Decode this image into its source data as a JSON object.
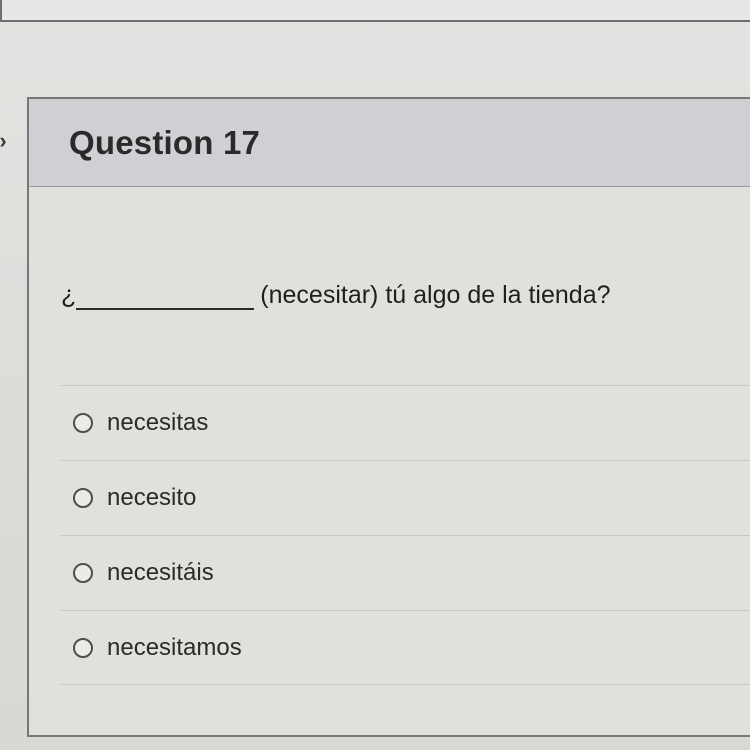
{
  "question": {
    "title": "Question 17",
    "prefix": "¿",
    "text": "(necesitar) tú algo de la tienda?"
  },
  "answers": [
    {
      "label": "necesitas"
    },
    {
      "label": "necesito"
    },
    {
      "label": "necesitáis"
    },
    {
      "label": "necesitamos"
    }
  ]
}
